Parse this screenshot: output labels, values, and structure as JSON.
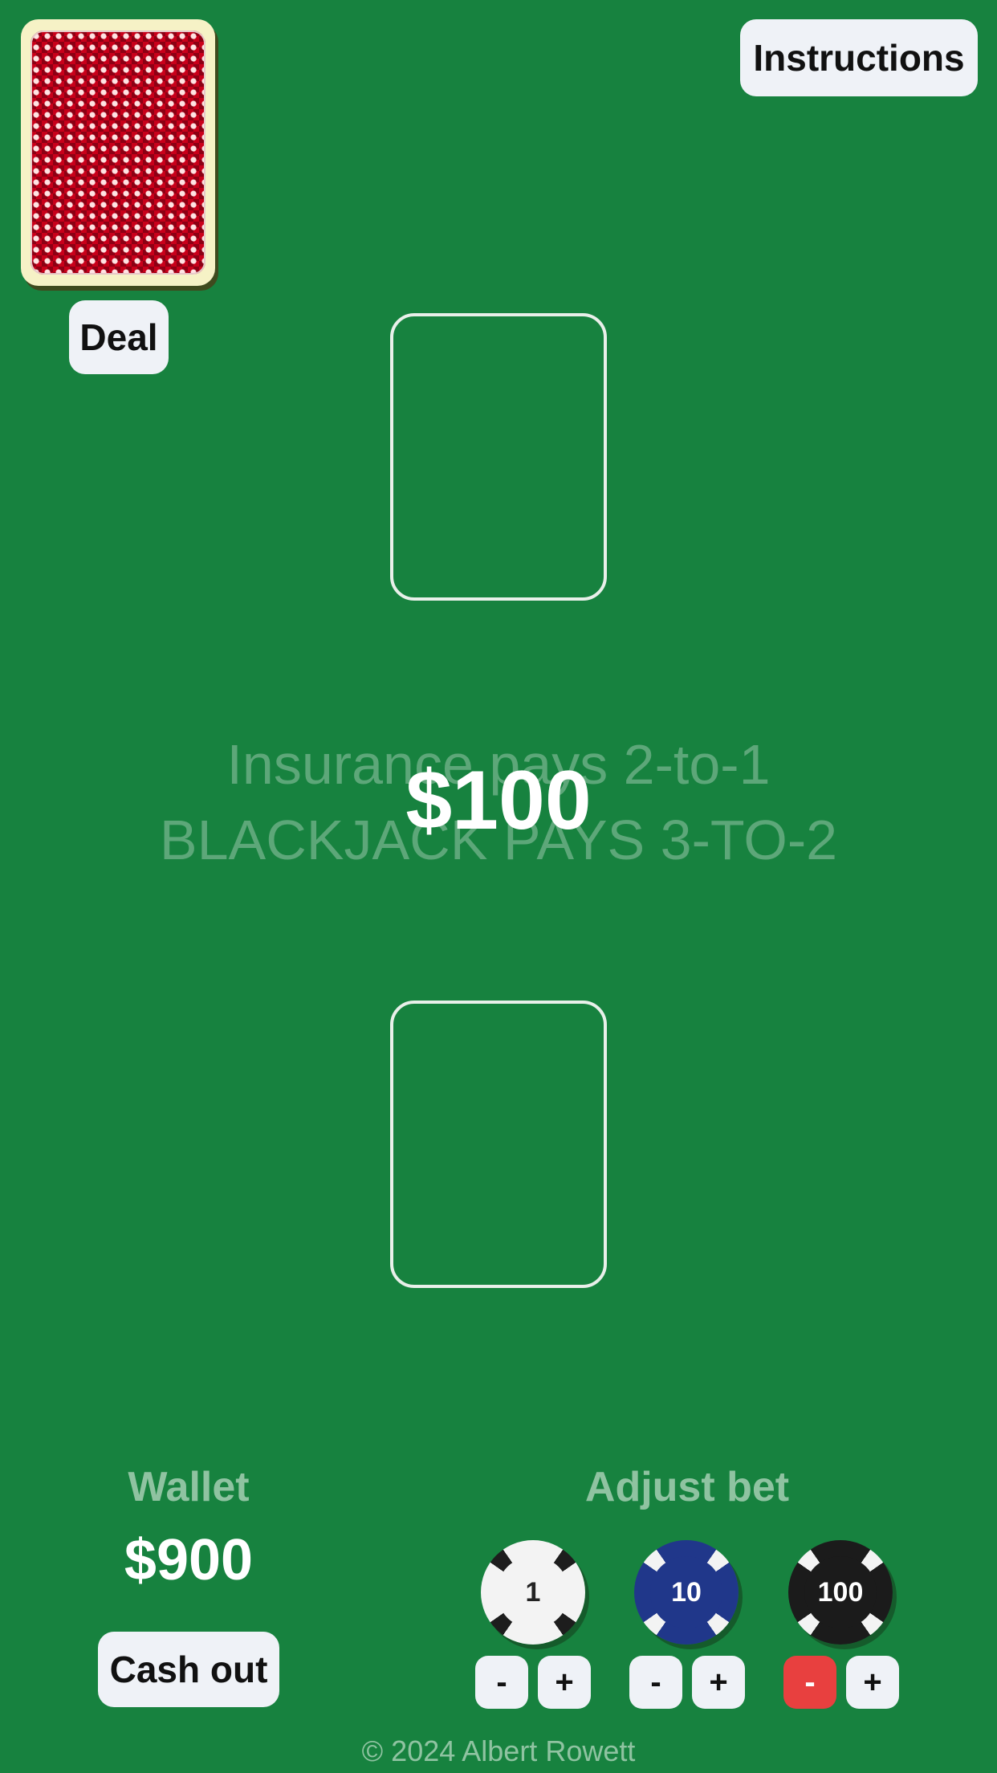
{
  "header": {
    "instructions_label": "Instructions"
  },
  "deck": {
    "deal_label": "Deal"
  },
  "table": {
    "insurance_rule": "Insurance pays 2-to-1",
    "blackjack_rule": "BLACKJACK PAYS 3-TO-2",
    "current_bet": "$100"
  },
  "wallet": {
    "label": "Wallet",
    "amount": "$900",
    "cash_out_label": "Cash out"
  },
  "bet_controls": {
    "label": "Adjust bet",
    "chips": [
      {
        "value": "1",
        "color": "#f3f3f3",
        "minus": "-",
        "plus": "+"
      },
      {
        "value": "10",
        "color": "#20378a",
        "minus": "-",
        "plus": "+"
      },
      {
        "value": "100",
        "color": "#1b1b1b",
        "minus": "-",
        "plus": "+"
      }
    ]
  },
  "footer": {
    "copyright": "© 2024 Albert Rowett"
  },
  "colors": {
    "table_felt": "#17823f",
    "button_bg": "#eff2f7",
    "disabled_minus": "#e8403f"
  }
}
